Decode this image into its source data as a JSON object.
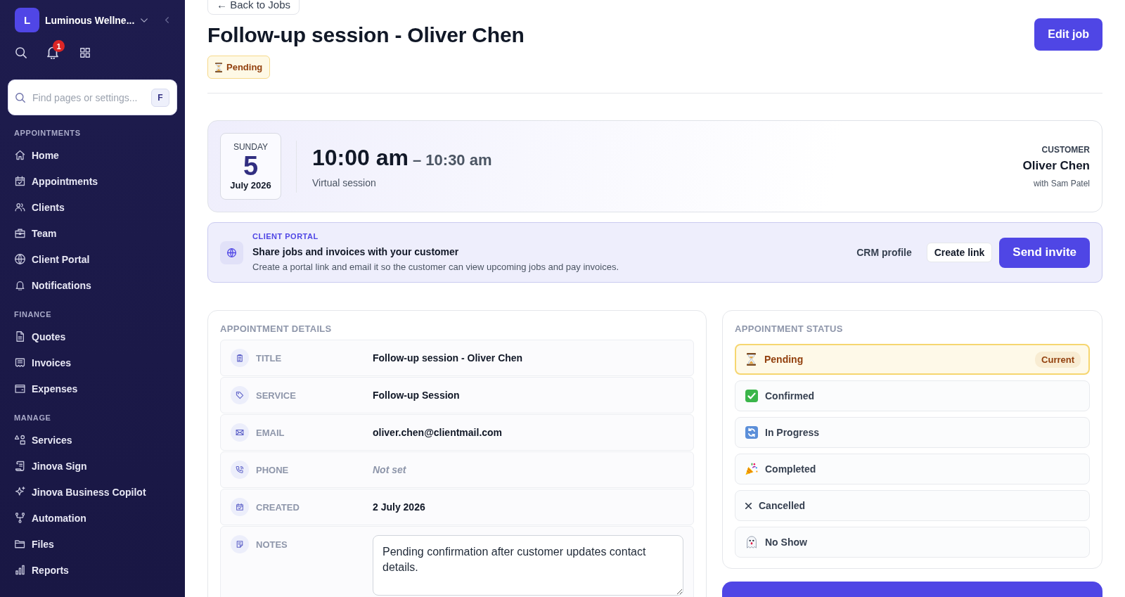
{
  "sidebar": {
    "workspace": {
      "initial": "L",
      "name": "Luminous Wellne..."
    },
    "notification_count": "1",
    "search": {
      "placeholder": "Find pages or settings...",
      "shortcut": "F"
    },
    "sections": [
      {
        "title": "APPOINTMENTS",
        "items": [
          {
            "label": "Home",
            "selected": false
          },
          {
            "label": "Appointments",
            "selected": false
          },
          {
            "label": "Clients",
            "selected": false
          },
          {
            "label": "Team",
            "selected": false
          },
          {
            "label": "Client Portal",
            "selected": false
          },
          {
            "label": "Notifications",
            "selected": false
          }
        ]
      },
      {
        "title": "FINANCE",
        "items": [
          {
            "label": "Quotes",
            "selected": false
          },
          {
            "label": "Invoices",
            "selected": false
          },
          {
            "label": "Expenses",
            "selected": false
          }
        ]
      },
      {
        "title": "MANAGE",
        "items": [
          {
            "label": "Services",
            "selected": false
          },
          {
            "label": "Jinova Sign",
            "selected": false
          },
          {
            "label": "Jinova Business Copilot",
            "selected": false
          },
          {
            "label": "Automation",
            "selected": false
          },
          {
            "label": "Files",
            "selected": false
          },
          {
            "label": "Reports",
            "selected": false
          }
        ]
      }
    ]
  },
  "header": {
    "back_link": "← Back to Jobs",
    "title": "Follow-up session - Oliver Chen",
    "status_badge": "Pending",
    "edit_button": "Edit job"
  },
  "schedule": {
    "weekday": "SUNDAY",
    "day": "5",
    "month_year": "July 2026",
    "start_time": "10:00 am",
    "end_time": "– 10:30 am",
    "location": "Virtual session",
    "customer_label": "CUSTOMER",
    "customer_name": "Oliver Chen",
    "staff": "with Sam Patel"
  },
  "client_portal": {
    "eyebrow": "CLIENT PORTAL",
    "heading": "Share jobs and invoices with your customer",
    "description": "Create a portal link and email it so the customer can view upcoming jobs and pay invoices.",
    "buttons": [
      {
        "label": "CRM profile",
        "kind": "text"
      },
      {
        "label": "Create link",
        "kind": "outline"
      },
      {
        "label": "Send invite",
        "kind": "primary"
      }
    ]
  },
  "appointment_details": {
    "title": "APPOINTMENT DETAILS",
    "fields": [
      {
        "label": "TITLE",
        "value": "Follow-up session - Oliver Chen",
        "kind": "text"
      },
      {
        "label": "SERVICE",
        "value": "Follow-up Session",
        "kind": "text"
      },
      {
        "label": "EMAIL",
        "value": "oliver.chen@clientmail.com",
        "kind": "text"
      },
      {
        "label": "PHONE",
        "value": "Not set",
        "kind": "unset"
      },
      {
        "label": "CREATED",
        "value": "2 July 2026",
        "kind": "text"
      },
      {
        "label": "NOTES",
        "value": "Pending confirmation after customer updates contact details.",
        "kind": "textarea"
      }
    ]
  },
  "appointment_status": {
    "title": "APPOINTMENT STATUS",
    "options": [
      {
        "label": "Pending",
        "selected": true,
        "badge": "Current"
      },
      {
        "label": "Confirmed",
        "selected": false
      },
      {
        "label": "In Progress",
        "selected": false
      },
      {
        "label": "Completed",
        "selected": false
      },
      {
        "label": "Cancelled",
        "selected": false
      },
      {
        "label": "No Show",
        "selected": false
      }
    ]
  }
}
